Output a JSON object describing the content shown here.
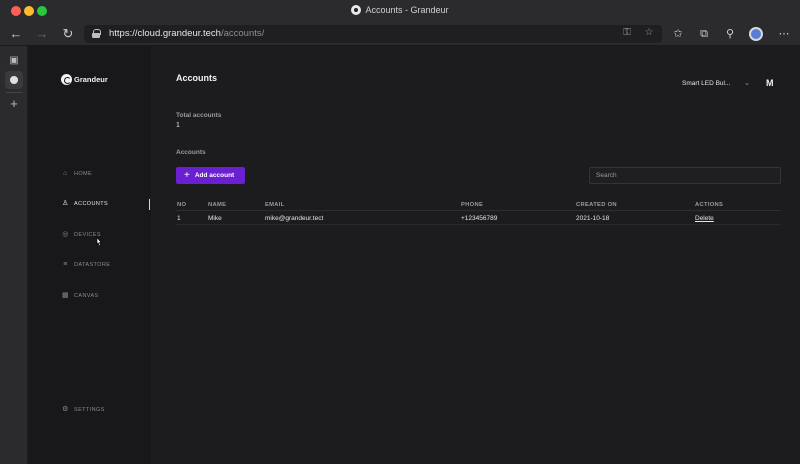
{
  "browser": {
    "window_title": "Accounts - Grandeur",
    "url_host": "https://cloud.grandeur.tech",
    "url_path": "/accounts/"
  },
  "brand": {
    "name": "Grandeur"
  },
  "sidebar": {
    "items": [
      {
        "label": "HOME",
        "icon": "home-icon"
      },
      {
        "label": "ACCOUNTS",
        "icon": "user-icon"
      },
      {
        "label": "DEVICES",
        "icon": "devices-icon"
      },
      {
        "label": "DATASTORE",
        "icon": "database-icon"
      },
      {
        "label": "CANVAS",
        "icon": "canvas-icon"
      }
    ],
    "settings": {
      "label": "SETTINGS",
      "icon": "gear-icon"
    },
    "active": "ACCOUNTS"
  },
  "header": {
    "title": "Accounts",
    "project": "Smart LED Bul...",
    "user_initial": "M"
  },
  "stats": {
    "total_label": "Total accounts",
    "total_value": "1"
  },
  "accounts": {
    "section_label": "Accounts",
    "add_label": "Add account",
    "search_placeholder": "Search",
    "columns": [
      "NO",
      "NAME",
      "EMAIL",
      "PHONE",
      "CREATED ON",
      "ACTIONS"
    ],
    "rows": [
      {
        "no": "1",
        "name": "Mike",
        "email": "mike@grandeur.tect",
        "phone": "+123456789",
        "created_on": "2021-10-18",
        "action": "Delete"
      }
    ]
  },
  "colors": {
    "accent": "#6a1fd0",
    "sidebar_bg": "#18181a",
    "main_bg": "#1c1c1f"
  }
}
